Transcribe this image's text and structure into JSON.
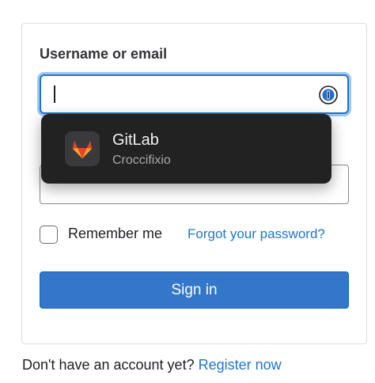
{
  "form": {
    "username_label": "Username or email",
    "username_value": "",
    "password_value": "",
    "remember_label": "Remember me",
    "forgot_link": "Forgot your password?",
    "signin_button": "Sign in"
  },
  "autofill": {
    "app_name": "GitLab",
    "account": "Croccifixio",
    "app_icon": "gitlab-tanuki-icon",
    "field_icon": "password-manager-icon"
  },
  "footer": {
    "prompt": "Don't have an account yet?",
    "register_link": "Register now"
  },
  "colors": {
    "accent": "#1f75cb",
    "button": "#3476c9",
    "popup_bg": "#222222"
  }
}
